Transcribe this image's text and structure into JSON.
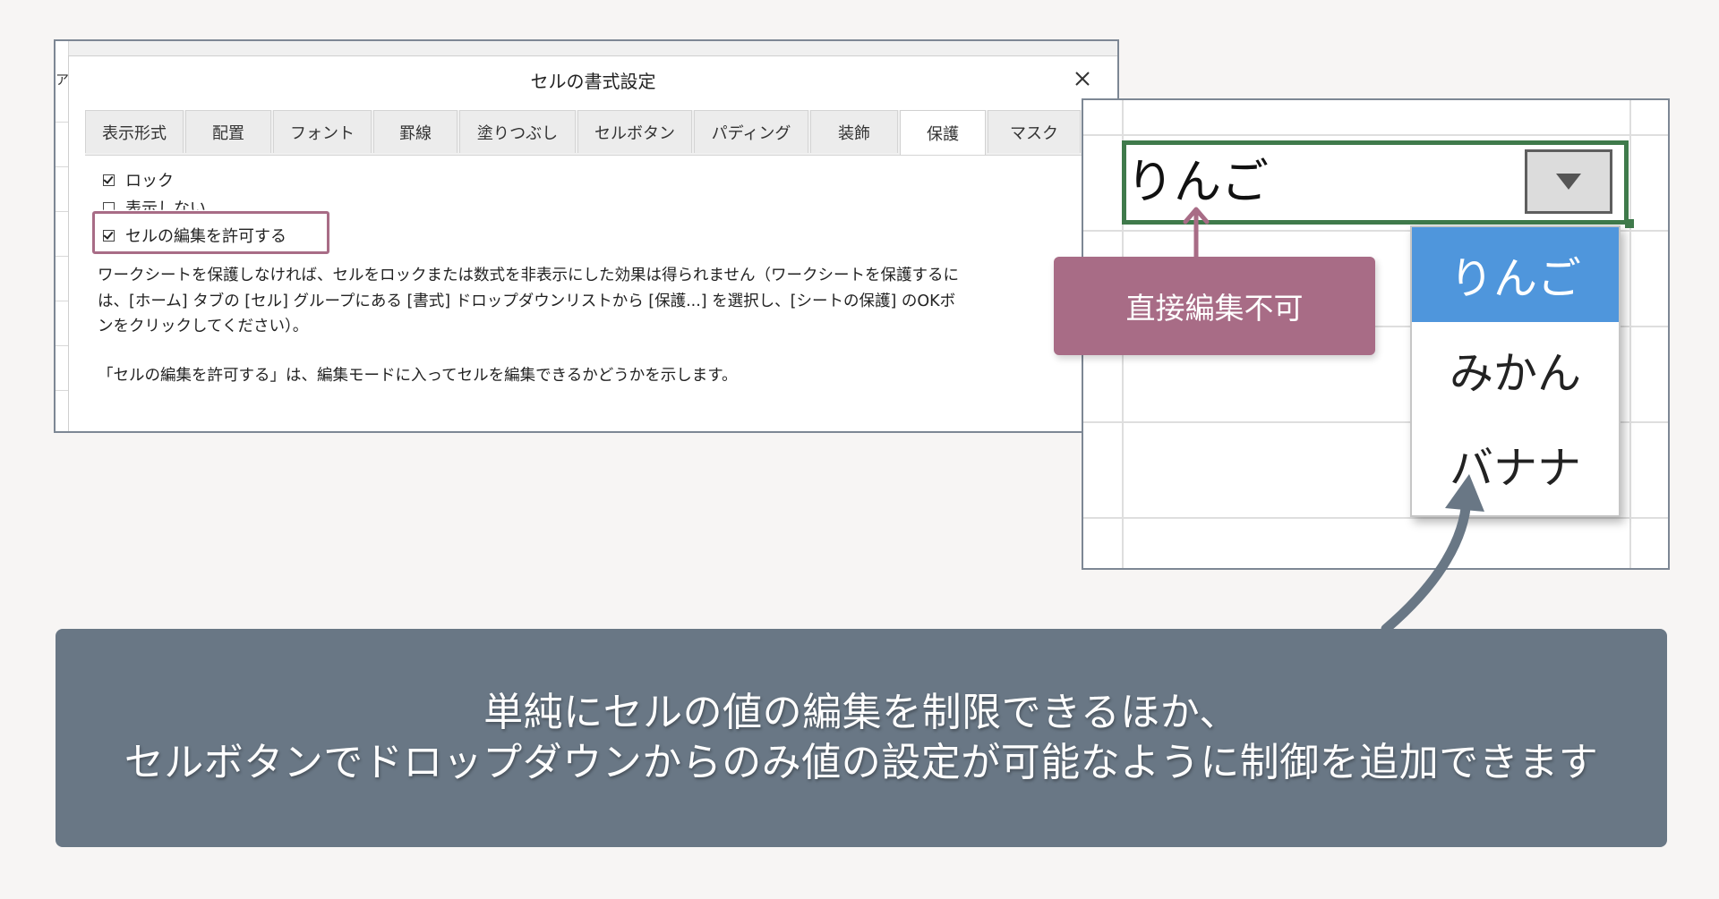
{
  "dialog": {
    "title": "セルの書式設定",
    "sheet_glyph": "ア",
    "tabs": [
      {
        "label": "表示形式",
        "active": false
      },
      {
        "label": "配置",
        "active": false
      },
      {
        "label": "フォント",
        "active": false
      },
      {
        "label": "罫線",
        "active": false
      },
      {
        "label": "塗りつぶし",
        "active": false
      },
      {
        "label": "セルボタン",
        "active": false
      },
      {
        "label": "パディング",
        "active": false
      },
      {
        "label": "装飾",
        "active": false
      },
      {
        "label": "保護",
        "active": true
      },
      {
        "label": "マスク",
        "active": false
      }
    ],
    "checkboxes": [
      {
        "label": "ロック",
        "checked": true
      },
      {
        "label": "表示しない",
        "checked": false
      },
      {
        "label": "セルの編集を許可する",
        "checked": true
      }
    ],
    "description_lines": [
      "ワークシートを保護しなければ、セルをロックまたは数式を非表示にした効果は得られません（ワークシートを保護するに",
      "は、[ホーム] タブの [セル] グループにある [書式] ドロップダウンリストから [保護...] を選択し、[シートの保護] のOKボ",
      "ンをクリックしてください）。"
    ],
    "note": "「セルの編集を許可する」は、編集モードに入ってセルを編集できるかどうかを示します。"
  },
  "sheet": {
    "cell_value": "りんご",
    "dropdown_items": [
      {
        "label": "りんご",
        "selected": true
      },
      {
        "label": "みかん",
        "selected": false
      },
      {
        "label": "バナナ",
        "selected": false
      }
    ]
  },
  "callout": {
    "label": "直接編集不可",
    "color": "#a86c86"
  },
  "caption": {
    "line1": "単純にセルの値の編集を制限できるほか、",
    "line2": "セルボタンでドロップダウンからのみ値の設定が可能なように制御を追加できます"
  },
  "colors": {
    "arrow": "#697785",
    "selected_item": "#4f96dc",
    "active_cell_border": "#3f7a4b"
  }
}
